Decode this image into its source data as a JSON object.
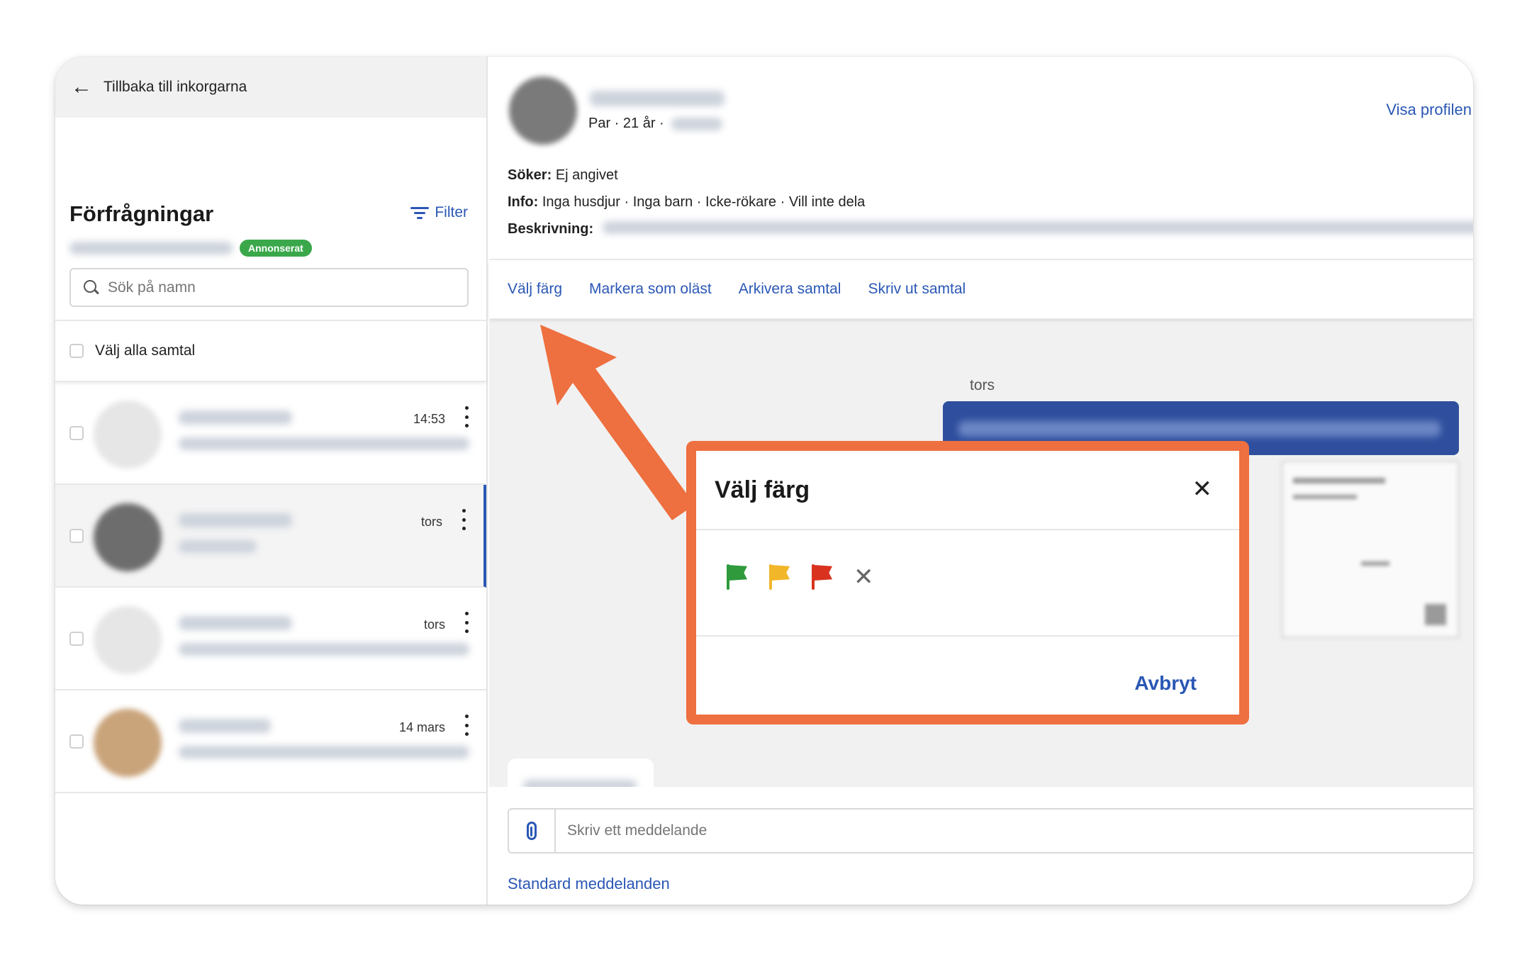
{
  "left": {
    "back_label": "Tillbaka till inkorgarna",
    "title": "Förfrågningar",
    "filter_label": "Filter",
    "badge": "Annonserat",
    "search_placeholder": "Sök på namn",
    "select_all": "Välj alla samtal",
    "conversations": [
      {
        "time": "14:53",
        "avatar_color": "#e8e8e8"
      },
      {
        "time": "tors",
        "avatar_color": "#6d6d6d"
      },
      {
        "time": "tors",
        "avatar_color": "#e8e8e8"
      },
      {
        "time": "14 mars",
        "avatar_color": "#c9a37a"
      }
    ]
  },
  "profile": {
    "meta": "Par · 21 år ·",
    "visa_label": "Visa profilen",
    "soker_label": "Söker:",
    "soker_value": "Ej angivet",
    "info_label": "Info:",
    "info_value": "Inga husdjur · Inga barn · Icke-rökare · Vill inte dela",
    "beskrivning_label": "Beskrivning:"
  },
  "actions": {
    "choose_color": "Välj färg",
    "mark_unread": "Markera som oläst",
    "archive": "Arkivera samtal",
    "print": "Skriv ut samtal"
  },
  "chat": {
    "day_label": "tors"
  },
  "composer": {
    "placeholder": "Skriv ett meddelande",
    "standard_messages": "Standard meddelanden"
  },
  "modal": {
    "title": "Välj färg",
    "close_glyph": "✕",
    "clear_glyph": "✕",
    "cancel": "Avbryt",
    "flags": [
      {
        "name": "green-flag-icon",
        "color": "#2e9a3c"
      },
      {
        "name": "yellow-flag-icon",
        "color": "#f2b62a"
      },
      {
        "name": "red-flag-icon",
        "color": "#d9321f"
      }
    ]
  },
  "colors": {
    "accent": "#2a57b5",
    "annotation": "#ee6f3f",
    "badge": "#3aa84a",
    "sent_bubble": "#2f4f9e"
  }
}
